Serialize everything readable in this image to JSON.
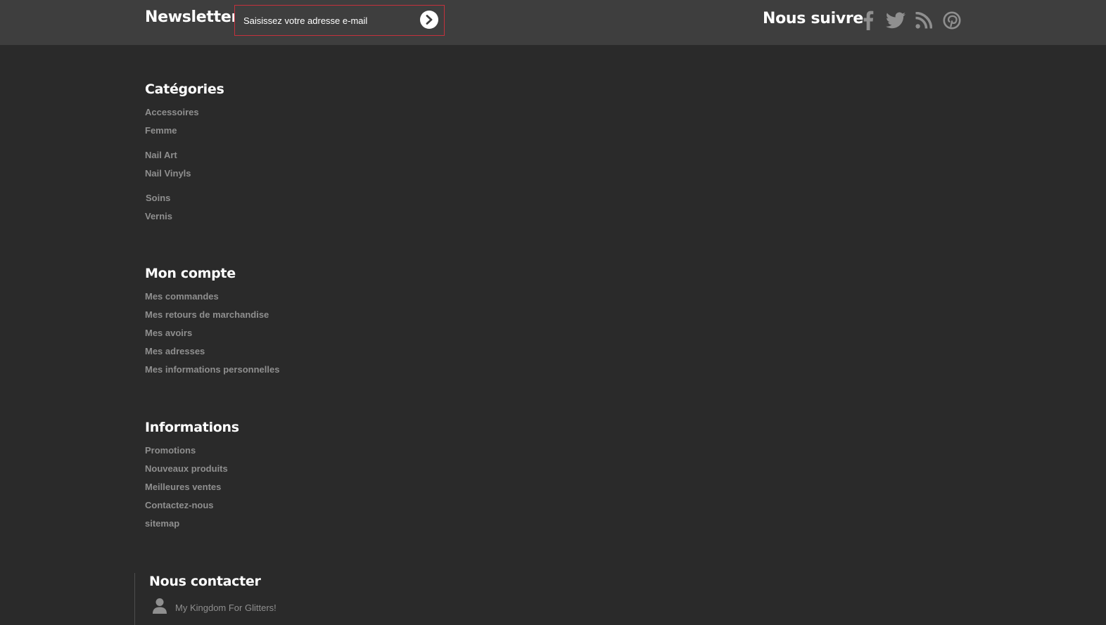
{
  "newsletter": {
    "title": "Newsletter",
    "placeholder": "Saisissez votre adresse e-mail",
    "submit_icon": "chevron-right-circle-icon",
    "border_color": "#c4313d"
  },
  "follow": {
    "title": "Nous suivre",
    "icons": [
      "facebook-icon",
      "twitter-icon",
      "rss-icon",
      "pinterest-icon"
    ]
  },
  "categories": {
    "title": "Catégories",
    "items": [
      "Accessoires",
      "Femme",
      "Nail Art",
      "Nail Vinyls",
      "Soins",
      "Vernis"
    ]
  },
  "account": {
    "title": "Mon compte",
    "items": [
      "Mes commandes",
      "Mes retours de marchandise",
      "Mes avoirs",
      "Mes adresses",
      "Mes informations personnelles"
    ]
  },
  "information": {
    "title": "Informations",
    "items": [
      "Promotions",
      "Nouveaux produits",
      "Meilleures ventes",
      "Contactez-nous",
      "sitemap"
    ]
  },
  "contact": {
    "title": "Nous contacter",
    "company": "My Kingdom For Glitters!"
  },
  "colors": {
    "topbar_bg": "#3e3e3e",
    "page_bg": "#2a2a2a",
    "link": "#8f8f8f",
    "heading": "#ffffff"
  }
}
